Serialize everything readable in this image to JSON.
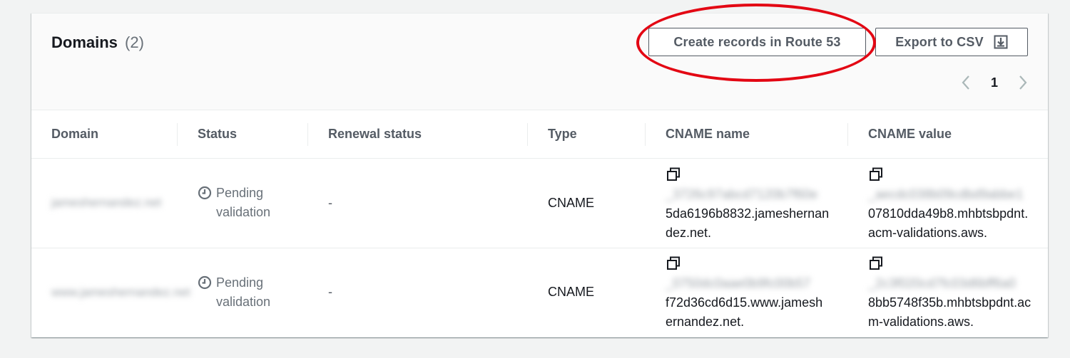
{
  "header": {
    "title": "Domains",
    "count": "(2)",
    "create_records_label": "Create records in Route 53",
    "export_label": "Export to CSV",
    "page_number": "1"
  },
  "table": {
    "columns": [
      "Domain",
      "Status",
      "Renewal status",
      "Type",
      "CNAME name",
      "CNAME value"
    ],
    "rows": [
      {
        "domain": "jameshernandez.net",
        "status": "Pending validation",
        "renewal_status": "-",
        "type": "CNAME",
        "cname_name_hidden": "_3726c97abcd7120b7f60e",
        "cname_name": "5da6196b8832.jameshernandez.net.",
        "cname_value_hidden": "_aecdc038b09cdbd9abbe1",
        "cname_value": "07810dda49b8.mhbtsbpdnt.acm-validations.aws."
      },
      {
        "domain": "www.jameshernandez.net",
        "status": "Pending validation",
        "renewal_status": "-",
        "type": "CNAME",
        "cname_name_hidden": "_0750dc0aae0b9fc00b57",
        "cname_name": "f72d36cd6d15.www.jameshernandez.net.",
        "cname_value_hidden": "_2c3f020cd7fc03d6bff6a0",
        "cname_value": "8bb5748f35b.mhbtsbpdnt.acm-validations.aws."
      }
    ]
  },
  "colors": {
    "highlight": "#e30613",
    "button_text": "#545b64",
    "muted": "#687078"
  },
  "icons": {
    "download": "download-icon",
    "prev": "chevron-left-icon",
    "next": "chevron-right-icon",
    "status": "clock-icon",
    "copy": "copy-icon"
  }
}
